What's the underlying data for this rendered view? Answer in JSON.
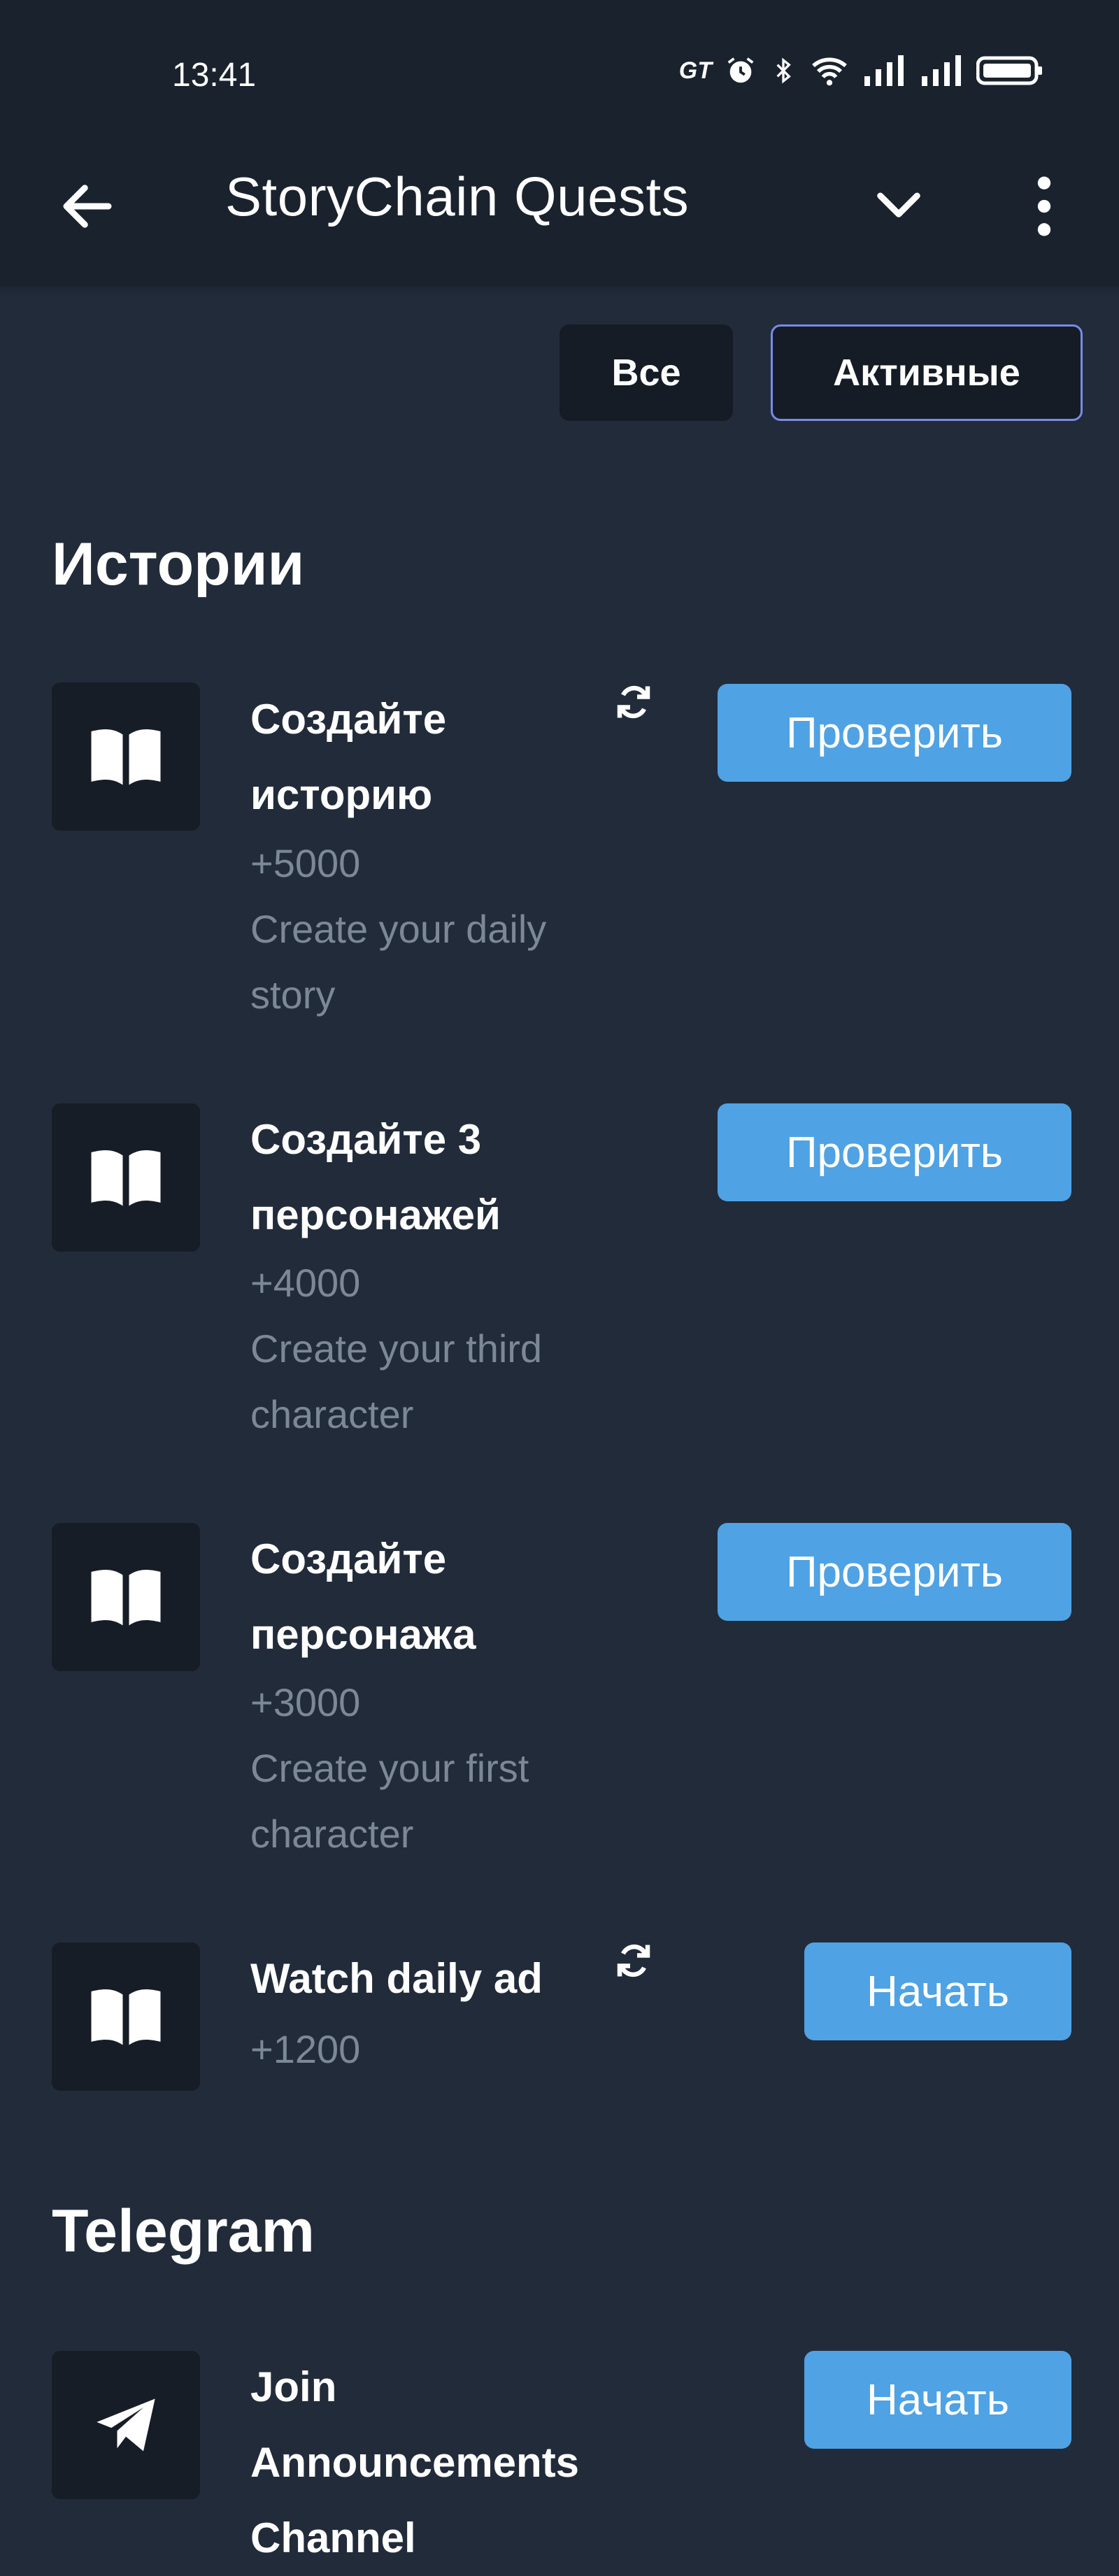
{
  "status_bar": {
    "time": "13:41",
    "carrier_badge": "GT",
    "icons": [
      "alarm-icon",
      "bluetooth-icon",
      "wifi-icon",
      "signal-icon",
      "signal-icon",
      "battery-icon"
    ]
  },
  "app_bar": {
    "title": "StoryChain Quests",
    "icons": {
      "back": "arrow-left-icon",
      "collapse": "chevron-down-icon",
      "menu": "more-vertical-icon"
    }
  },
  "filters": {
    "all_label": "Все",
    "active_label": "Активные",
    "selected": "active"
  },
  "sections": [
    {
      "title": "Истории",
      "quests": [
        {
          "title_line1": "Создайте",
          "title_line2": "историю",
          "reward": "+5000",
          "desc_line1": "Create your daily",
          "desc_line2": "story",
          "button": "Проверить",
          "repeatable": true,
          "icon": "book-icon"
        },
        {
          "title_line1": "Создайте 3",
          "title_line2": "персонажей",
          "reward": "+4000",
          "desc_line1": "Create your third",
          "desc_line2": "character",
          "button": "Проверить",
          "repeatable": false,
          "icon": "book-icon"
        },
        {
          "title_line1": "Создайте",
          "title_line2": "персонажа",
          "reward": "+3000",
          "desc_line1": "Create your first",
          "desc_line2": "character",
          "button": "Проверить",
          "repeatable": false,
          "icon": "book-icon"
        },
        {
          "title_line1": "Watch daily ad",
          "reward": "+1200",
          "button": "Начать",
          "repeatable": true,
          "icon": "book-icon"
        }
      ]
    },
    {
      "title": "Telegram",
      "quests": [
        {
          "title_line1": "Join Announcements",
          "title_line2": "Channel",
          "button": "Начать",
          "icon": "telegram-send-icon"
        }
      ]
    }
  ],
  "colors": {
    "background": "#212b39",
    "bar": "#1a222e",
    "tile": "#161d27",
    "button": "#4fa2e3",
    "muted_text": "#7d8896",
    "active_filter_border": "#7b8ae6"
  }
}
